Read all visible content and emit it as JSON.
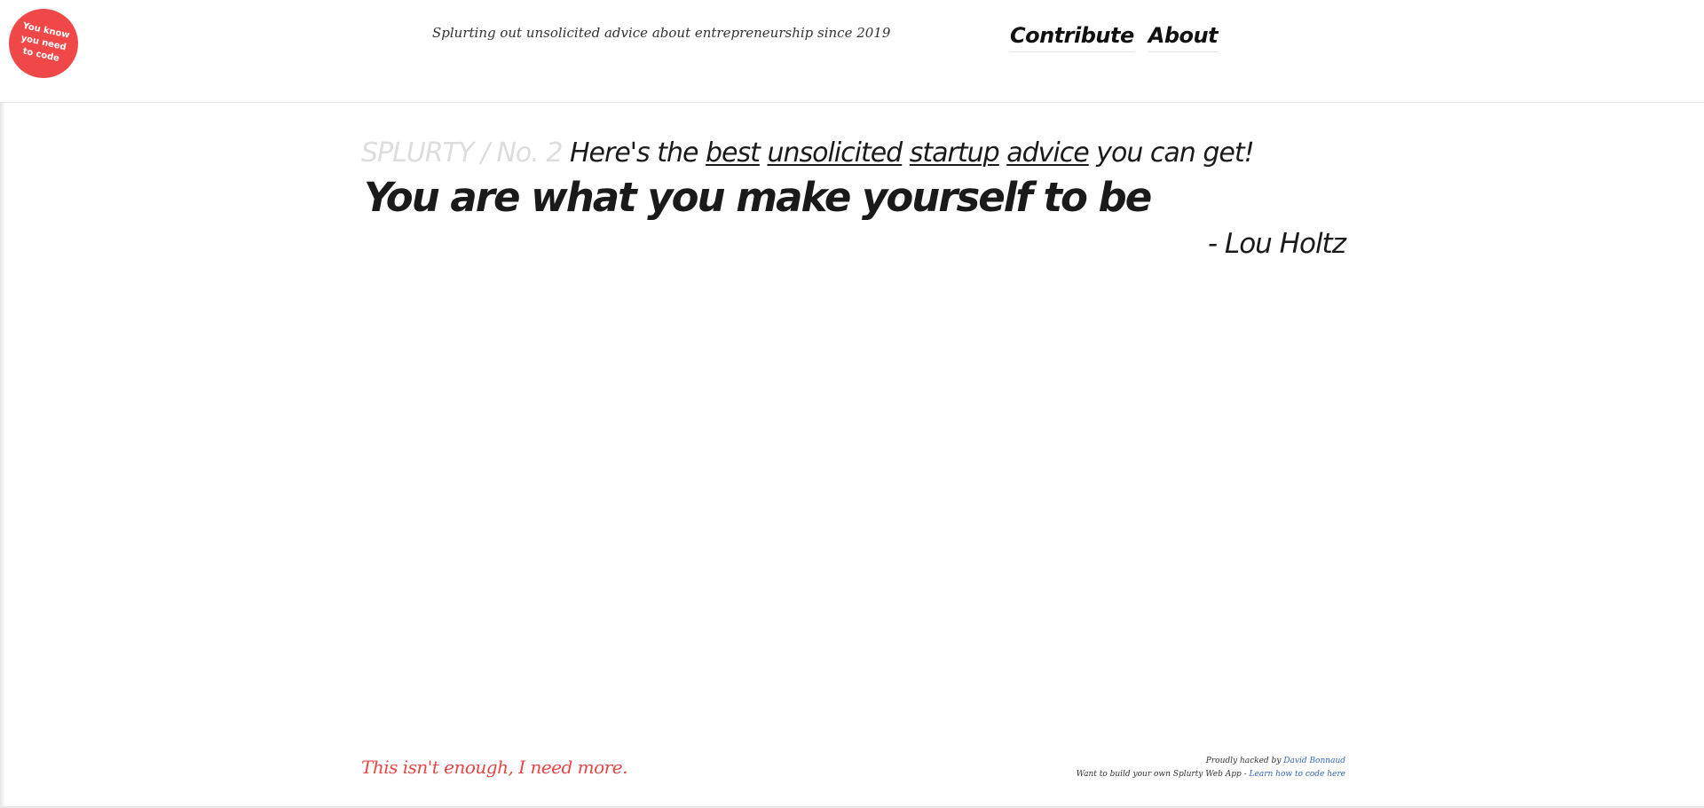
{
  "badge": {
    "text": "You know you need to code",
    "color": "#f04848"
  },
  "header": {
    "tagline": "Splurting out unsolicited advice about entrepreneurship since 2019",
    "nav": {
      "contribute": "Contribute",
      "about": "About"
    }
  },
  "main": {
    "issue": "SPLURTY / No. 2",
    "intro": {
      "prefix": "Here's the",
      "underlined": [
        "best",
        "unsolicited",
        "startup",
        "advice"
      ],
      "suffix": "you can get!"
    },
    "quote": "You are what you make yourself to be",
    "author": "- Lou Holtz"
  },
  "footer": {
    "more_link": "This isn't enough, I need more.",
    "credit_prefix": "Proudly hacked by",
    "credit_name": "David Bonnaud",
    "build_prefix": "Want to build your own Splurty Web App -",
    "build_link": "Learn how to code here"
  },
  "colors": {
    "accent": "#e84545",
    "link": "#3366bb",
    "issue": "#dddddd"
  }
}
